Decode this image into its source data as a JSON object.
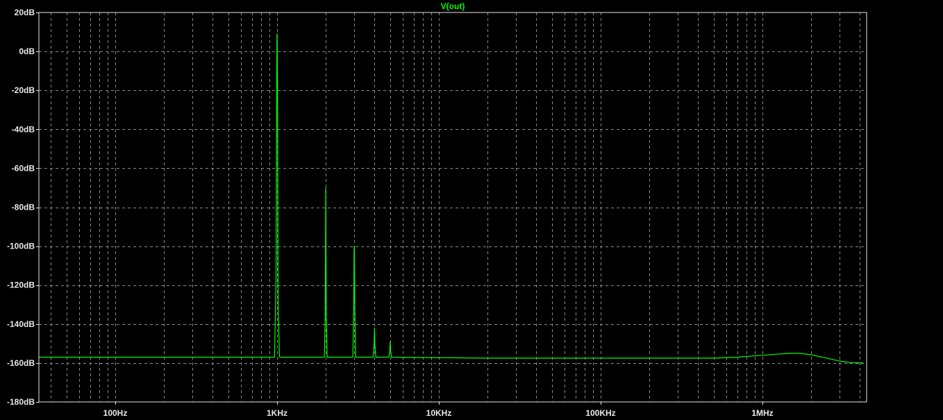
{
  "chart_data": {
    "type": "line",
    "title": "V(out)",
    "xlabel": "",
    "ylabel": "",
    "x_scale": "log",
    "xlim": [
      32,
      420000
    ],
    "ylim": [
      -180,
      20
    ],
    "grid": true,
    "y_ticks": [
      {
        "value": 20,
        "label": "20dB"
      },
      {
        "value": 0,
        "label": "0dB"
      },
      {
        "value": -20,
        "label": "-20dB"
      },
      {
        "value": -40,
        "label": "-40dB"
      },
      {
        "value": -60,
        "label": "-60dB"
      },
      {
        "value": -80,
        "label": "-80dB"
      },
      {
        "value": -100,
        "label": "-100dB"
      },
      {
        "value": -120,
        "label": "-120dB"
      },
      {
        "value": -140,
        "label": "-140dB"
      },
      {
        "value": -160,
        "label": "-160dB"
      },
      {
        "value": -180,
        "label": "-180dB"
      }
    ],
    "x_ticks": [
      {
        "value": 100,
        "label": "100Hz"
      },
      {
        "value": 1000,
        "label": "1KHz"
      },
      {
        "value": 10000,
        "label": "10KHz"
      },
      {
        "value": 100000,
        "label": "100KHz"
      },
      {
        "value": 1000000,
        "label": "1MHz"
      }
    ],
    "series": [
      {
        "name": "V(out)",
        "color": "#00ff00",
        "x": [
          32,
          900,
          965,
          985,
          993,
          998,
          1000,
          1002,
          1007,
          1015,
          1035,
          1060,
          1960,
          1985,
          1995,
          2000,
          2005,
          2015,
          2040,
          2940,
          2980,
          2995,
          3000,
          3005,
          3020,
          3060,
          3920,
          3980,
          4000,
          4020,
          4080,
          4900,
          4970,
          5000,
          5030,
          5100,
          20000,
          200000,
          500000,
          700000,
          1000000,
          1200000,
          1500000,
          1700000,
          2000000,
          2500000,
          3000000,
          3500000,
          4200000
        ],
        "y": [
          -157,
          -157,
          -157,
          -117,
          -37,
          5,
          9,
          5,
          -19,
          -130,
          -157,
          -157,
          -157,
          -135,
          -92,
          -70,
          -92,
          -135,
          -157,
          -157,
          -128,
          -100,
          -100,
          -100,
          -128,
          -157,
          -157,
          -150,
          -142,
          -150,
          -157,
          -157,
          -154,
          -149,
          -154,
          -157,
          -157.5,
          -157.5,
          -157.5,
          -157,
          -156,
          -155.5,
          -155,
          -155,
          -155.8,
          -157.5,
          -159,
          -159.8,
          -160
        ]
      }
    ]
  }
}
